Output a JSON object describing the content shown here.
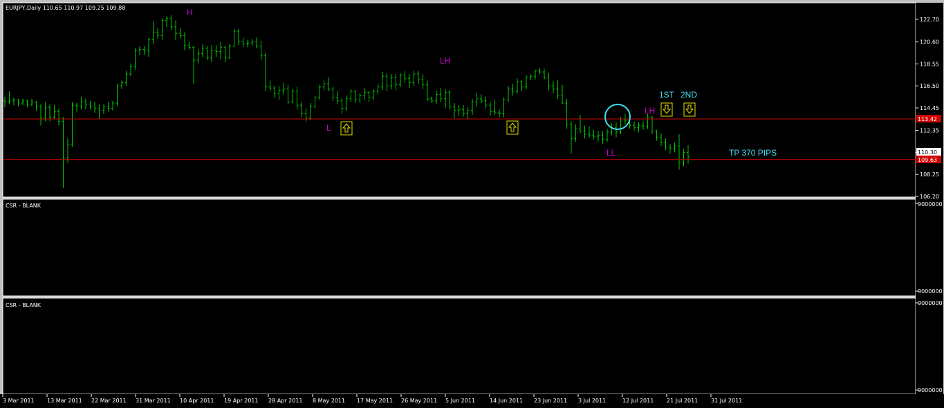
{
  "window": {
    "symbol_header": "EURJPY,Daily  110.65 110.97 109.25 109.88"
  },
  "colors": {
    "background": "#000000",
    "bar": "#00c800",
    "hline": "#d00000",
    "annotation_magenta": "#d000d0",
    "annotation_cyan": "#40e0f0",
    "arrow_box": "#e8e000",
    "price_tag": "#d00000"
  },
  "panels": {
    "sub1_title": "CSR - BLANK",
    "sub1_top": "9000000",
    "sub1_bottom": "9000000",
    "sub2_title": "CSR - BLANK",
    "sub2_top": "9000000",
    "sub2_bottom": "9000000"
  },
  "price_tags": {
    "upper": "113.42",
    "lower": "109.63",
    "current": "110.30"
  },
  "annotations": {
    "h": "H",
    "lh1": "LH",
    "l": "L",
    "ll": "LL",
    "lh2": "LH",
    "first": "1ST",
    "second": "2ND",
    "tp": "TP 370 PIPS"
  },
  "chart_data": {
    "type": "ohlc",
    "symbol": "EURJPY",
    "timeframe": "Daily",
    "y_ticks": [
      "122.70",
      "120.60",
      "118.55",
      "116.50",
      "114.45",
      "112.35",
      "110.30",
      "108.25",
      "106.20"
    ],
    "ylim": [
      106.2,
      122.7
    ],
    "x_ticks": [
      "3 Mar 2011",
      "13 Mar 2011",
      "22 Mar 2011",
      "31 Mar 2011",
      "10 Apr 2011",
      "19 Apr 2011",
      "28 Apr 2011",
      "8 May 2011",
      "17 May 2011",
      "26 May 2011",
      "5 Jun 2011",
      "14 Jun 2011",
      "23 Jun 2011",
      "3 Jul 2011",
      "12 Jul 2011",
      "21 Jul 2011",
      "31 Jul 2011"
    ],
    "horizontal_lines": [
      113.42,
      109.63
    ],
    "bars": [
      [
        115.1,
        115.5,
        114.5,
        115.0
      ],
      [
        115.0,
        116.0,
        114.8,
        115.1
      ],
      [
        115.1,
        115.4,
        114.7,
        115.2
      ],
      [
        115.2,
        115.3,
        114.6,
        114.9
      ],
      [
        114.9,
        115.3,
        114.7,
        115.1
      ],
      [
        115.1,
        115.2,
        114.5,
        114.8
      ],
      [
        114.8,
        115.3,
        114.6,
        115.0
      ],
      [
        115.0,
        115.1,
        114.2,
        114.6
      ],
      [
        114.6,
        114.8,
        112.8,
        113.5
      ],
      [
        113.5,
        115.0,
        113.2,
        114.5
      ],
      [
        114.5,
        114.8,
        113.2,
        113.6
      ],
      [
        113.6,
        114.7,
        113.4,
        114.1
      ],
      [
        114.1,
        114.4,
        112.8,
        113.2
      ],
      [
        113.2,
        113.6,
        107.0,
        109.8
      ],
      [
        109.8,
        111.6,
        109.3,
        111.0
      ],
      [
        111.0,
        115.0,
        110.8,
        114.7
      ],
      [
        114.7,
        114.9,
        114.1,
        114.6
      ],
      [
        114.6,
        115.5,
        114.3,
        115.0
      ],
      [
        115.0,
        115.3,
        114.3,
        114.8
      ],
      [
        114.8,
        115.1,
        114.3,
        114.6
      ],
      [
        114.6,
        115.0,
        114.0,
        114.4
      ],
      [
        114.4,
        114.8,
        113.4,
        114.2
      ],
      [
        114.2,
        114.8,
        113.9,
        114.6
      ],
      [
        114.6,
        115.0,
        114.1,
        114.4
      ],
      [
        114.4,
        115.1,
        114.2,
        114.9
      ],
      [
        114.9,
        116.7,
        114.6,
        116.5
      ],
      [
        116.5,
        117.0,
        116.2,
        116.8
      ],
      [
        116.8,
        117.9,
        116.5,
        117.6
      ],
      [
        117.6,
        118.6,
        117.4,
        118.3
      ],
      [
        118.3,
        120.0,
        118.0,
        119.8
      ],
      [
        119.8,
        120.2,
        119.4,
        119.9
      ],
      [
        119.9,
        120.2,
        119.4,
        119.8
      ],
      [
        119.8,
        121.0,
        119.2,
        120.8
      ],
      [
        120.8,
        122.5,
        120.4,
        121.5
      ],
      [
        121.5,
        121.9,
        120.9,
        121.2
      ],
      [
        121.2,
        122.8,
        120.8,
        122.6
      ],
      [
        122.6,
        123.0,
        122.0,
        122.8
      ],
      [
        122.8,
        123.1,
        121.7,
        122.0
      ],
      [
        122.0,
        122.6,
        120.8,
        121.4
      ],
      [
        121.4,
        121.9,
        120.9,
        121.2
      ],
      [
        121.2,
        121.5,
        119.8,
        120.3
      ],
      [
        120.3,
        120.6,
        119.9,
        120.1
      ],
      [
        120.1,
        120.2,
        116.7,
        118.9
      ],
      [
        118.9,
        119.9,
        118.6,
        119.5
      ],
      [
        119.5,
        120.4,
        119.2,
        120.0
      ],
      [
        120.0,
        120.2,
        118.9,
        119.1
      ],
      [
        119.1,
        120.3,
        118.7,
        119.8
      ],
      [
        119.8,
        120.3,
        119.2,
        119.7
      ],
      [
        119.7,
        120.6,
        119.0,
        120.1
      ],
      [
        120.1,
        120.2,
        118.7,
        119.1
      ],
      [
        119.1,
        120.4,
        119.0,
        120.2
      ],
      [
        120.2,
        121.8,
        120.1,
        121.6
      ],
      [
        121.6,
        121.8,
        120.3,
        120.6
      ],
      [
        120.6,
        121.0,
        120.1,
        120.4
      ],
      [
        120.4,
        120.8,
        120.1,
        120.5
      ],
      [
        120.5,
        120.9,
        120.2,
        120.6
      ],
      [
        120.6,
        121.0,
        120.0,
        120.2
      ],
      [
        120.2,
        120.7,
        118.9,
        119.3
      ],
      [
        119.3,
        119.6,
        116.0,
        116.4
      ],
      [
        116.4,
        117.0,
        116.0,
        116.3
      ],
      [
        116.3,
        116.5,
        115.4,
        115.8
      ],
      [
        115.8,
        116.5,
        115.2,
        116.1
      ],
      [
        116.1,
        116.8,
        115.7,
        116.2
      ],
      [
        116.2,
        116.6,
        114.8,
        115.0
      ],
      [
        115.0,
        116.2,
        114.9,
        116.0
      ],
      [
        116.0,
        116.4,
        114.3,
        114.7
      ],
      [
        114.7,
        115.0,
        113.6,
        113.9
      ],
      [
        113.9,
        114.4,
        113.2,
        113.5
      ],
      [
        113.5,
        114.9,
        113.3,
        114.6
      ],
      [
        114.6,
        115.6,
        114.4,
        115.4
      ],
      [
        115.4,
        116.6,
        115.2,
        116.4
      ],
      [
        116.4,
        117.0,
        116.1,
        116.7
      ],
      [
        116.7,
        117.3,
        116.0,
        116.2
      ],
      [
        116.2,
        116.4,
        115.1,
        115.4
      ],
      [
        115.4,
        116.0,
        114.8,
        115.1
      ],
      [
        115.1,
        115.4,
        113.9,
        114.4
      ],
      [
        114.4,
        115.6,
        114.2,
        115.3
      ],
      [
        115.3,
        116.2,
        115.0,
        116.0
      ],
      [
        116.0,
        116.1,
        114.9,
        115.2
      ],
      [
        115.2,
        115.8,
        114.9,
        115.6
      ],
      [
        115.6,
        116.3,
        115.2,
        115.9
      ],
      [
        115.9,
        116.0,
        115.0,
        115.4
      ],
      [
        115.4,
        116.2,
        115.2,
        116.0
      ],
      [
        116.0,
        116.7,
        115.7,
        116.4
      ],
      [
        116.4,
        117.8,
        116.1,
        117.4
      ],
      [
        117.4,
        117.7,
        116.0,
        116.5
      ],
      [
        116.5,
        117.6,
        116.2,
        117.3
      ],
      [
        117.3,
        117.6,
        116.1,
        116.6
      ],
      [
        116.6,
        117.7,
        116.4,
        117.5
      ],
      [
        117.5,
        117.9,
        116.8,
        117.2
      ],
      [
        117.2,
        117.6,
        116.3,
        116.8
      ],
      [
        116.8,
        117.9,
        116.5,
        117.6
      ],
      [
        117.6,
        117.9,
        116.7,
        117.1
      ],
      [
        117.1,
        117.6,
        116.2,
        116.6
      ],
      [
        116.6,
        117.0,
        115.1,
        115.3
      ],
      [
        115.3,
        115.5,
        114.9,
        115.1
      ],
      [
        115.1,
        116.1,
        114.8,
        115.7
      ],
      [
        115.7,
        116.3,
        115.0,
        115.3
      ],
      [
        115.3,
        116.2,
        114.4,
        115.9
      ],
      [
        115.9,
        116.1,
        114.3,
        114.6
      ],
      [
        114.6,
        114.9,
        113.5,
        114.2
      ],
      [
        114.2,
        114.7,
        113.7,
        114.3
      ],
      [
        114.3,
        114.7,
        113.6,
        113.9
      ],
      [
        113.9,
        114.5,
        113.4,
        114.2
      ],
      [
        114.2,
        115.3,
        113.8,
        115.0
      ],
      [
        115.0,
        115.8,
        114.6,
        115.3
      ],
      [
        115.3,
        115.7,
        114.9,
        115.1
      ],
      [
        115.1,
        115.5,
        114.4,
        114.7
      ],
      [
        114.7,
        115.0,
        113.7,
        114.1
      ],
      [
        114.1,
        115.2,
        113.8,
        114.0
      ],
      [
        114.0,
        114.3,
        113.6,
        113.9
      ],
      [
        113.9,
        115.4,
        113.6,
        115.2
      ],
      [
        115.2,
        116.5,
        115.0,
        116.2
      ],
      [
        116.2,
        116.7,
        115.6,
        116.0
      ],
      [
        116.0,
        117.2,
        115.8,
        116.9
      ],
      [
        116.9,
        117.0,
        116.0,
        116.4
      ],
      [
        116.4,
        117.5,
        116.2,
        117.3
      ],
      [
        117.3,
        117.6,
        117.0,
        117.4
      ],
      [
        117.4,
        118.0,
        117.1,
        117.9
      ],
      [
        117.9,
        118.2,
        117.6,
        117.8
      ],
      [
        117.8,
        118.1,
        117.1,
        117.3
      ],
      [
        117.3,
        117.7,
        116.1,
        116.5
      ],
      [
        116.5,
        116.9,
        115.8,
        116.2
      ],
      [
        116.2,
        117.0,
        115.3,
        115.6
      ],
      [
        115.6,
        116.6,
        114.8,
        114.9
      ],
      [
        114.9,
        115.3,
        112.5,
        112.9
      ],
      [
        112.9,
        113.2,
        110.2,
        111.6
      ],
      [
        111.6,
        112.9,
        111.3,
        112.5
      ],
      [
        112.5,
        113.8,
        112.1,
        112.3
      ],
      [
        112.3,
        112.8,
        111.6,
        112.0
      ],
      [
        112.0,
        112.7,
        111.7,
        111.9
      ],
      [
        111.9,
        112.4,
        111.5,
        111.8
      ],
      [
        111.8,
        112.3,
        111.3,
        111.9
      ],
      [
        111.9,
        112.3,
        111.1,
        111.5
      ],
      [
        111.5,
        112.5,
        111.3,
        112.2
      ],
      [
        112.2,
        113.0,
        111.9,
        112.6
      ],
      [
        112.6,
        113.1,
        111.7,
        112.2
      ],
      [
        112.2,
        113.6,
        112.0,
        113.3
      ],
      [
        113.3,
        113.9,
        112.9,
        113.3
      ],
      [
        113.3,
        113.6,
        112.5,
        112.8
      ],
      [
        112.8,
        113.2,
        112.3,
        112.6
      ],
      [
        112.6,
        113.1,
        112.2,
        112.8
      ],
      [
        112.8,
        113.2,
        112.4,
        112.7
      ],
      [
        112.7,
        113.9,
        112.5,
        113.6
      ],
      [
        113.6,
        113.7,
        112.0,
        112.3
      ],
      [
        112.3,
        112.4,
        111.4,
        111.7
      ],
      [
        111.7,
        112.1,
        110.9,
        111.2
      ],
      [
        111.2,
        111.6,
        110.5,
        110.8
      ],
      [
        110.8,
        111.1,
        110.2,
        110.7
      ],
      [
        110.7,
        111.2,
        110.3,
        110.9
      ],
      [
        110.9,
        112.0,
        108.7,
        109.4
      ],
      [
        109.4,
        110.6,
        109.0,
        110.3
      ],
      [
        110.3,
        110.97,
        109.25,
        109.88
      ]
    ]
  }
}
